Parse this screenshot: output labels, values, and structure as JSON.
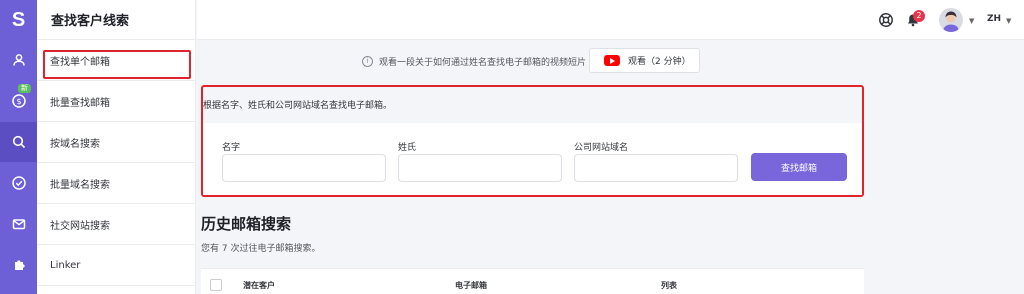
{
  "app": {
    "logo": "S",
    "new_badge": "新"
  },
  "sidebar": {
    "title": "查找客户线索",
    "items": [
      {
        "label": "查找单个邮箱"
      },
      {
        "label": "批量查找邮箱"
      },
      {
        "label": "按域名搜索"
      },
      {
        "label": "批量域名搜索"
      },
      {
        "label": "社交网站搜索"
      },
      {
        "label": "Linker"
      }
    ]
  },
  "topbar": {
    "notification_count": "2",
    "language": "ZH"
  },
  "hint": {
    "text": "观看一段关于如何通过姓名查找电子邮箱的视频短片",
    "watch_label": "观看（2 分钟）"
  },
  "form": {
    "description": "根据名字、姓氏和公司网站域名查找电子邮箱。",
    "first_name_label": "名字",
    "last_name_label": "姓氏",
    "domain_label": "公司网站域名",
    "first_name_value": "",
    "last_name_value": "",
    "domain_value": "",
    "submit_label": "查找邮箱"
  },
  "history": {
    "title": "历史邮箱搜索",
    "subtitle": "您有 7 次过往电子邮箱搜索。",
    "columns": [
      "潜在客户",
      "电子邮箱",
      "列表"
    ]
  },
  "colors": {
    "accent": "#7a66db",
    "rail": "#6d5fd6",
    "highlight": "#e0242e"
  }
}
